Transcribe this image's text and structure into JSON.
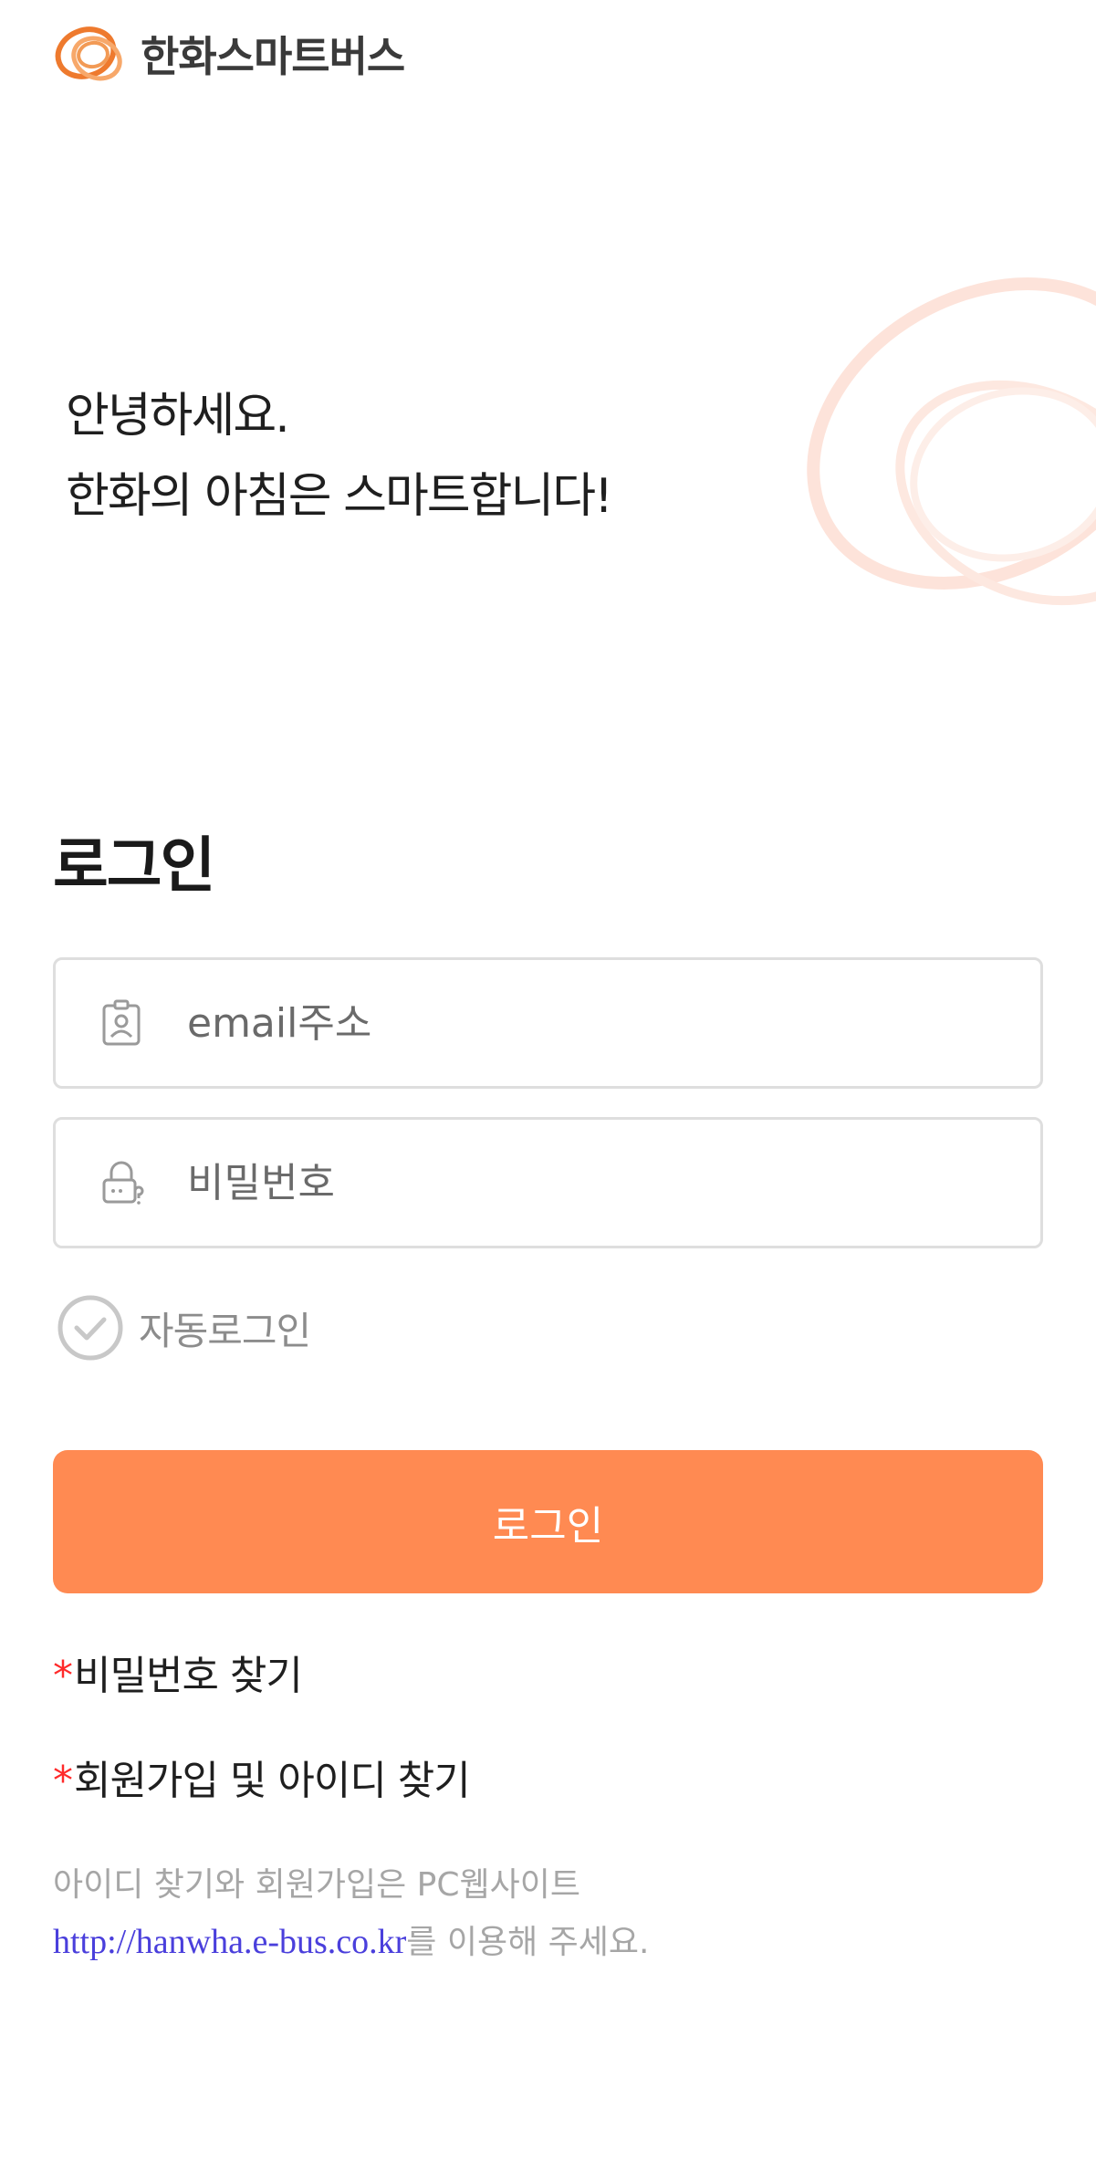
{
  "header": {
    "brand_name": "한화스마트버스"
  },
  "greeting": {
    "line1": "안녕하세요.",
    "line2": "한화의 아침은 스마트합니다!"
  },
  "login": {
    "title": "로그인",
    "email_placeholder": "email주소",
    "password_placeholder": "비밀번호",
    "auto_login_label": "자동로그인",
    "auto_login_checked": false,
    "button_label": "로그인"
  },
  "links": {
    "asterisk": "*",
    "find_password": "비밀번호 찾기",
    "signup_find_id": "회원가입 및 아이디 찾기"
  },
  "notice": {
    "line1": "아이디 찾기와 회원가입은 PC웹사이트",
    "url": "http://hanwha.e-bus.co.kr",
    "line2_suffix": "를 이용해 주세요."
  },
  "colors": {
    "accent": "#ff8a52",
    "brand_orange": "#f07a32",
    "asterisk": "#ff2a2a",
    "link": "#4a3fdc",
    "muted_text": "#a6a6a6"
  },
  "icons": {
    "logo": "hanwha-logo-icon",
    "email": "id-badge-icon",
    "password": "lock-icon",
    "auto_login": "check-circle-icon"
  }
}
